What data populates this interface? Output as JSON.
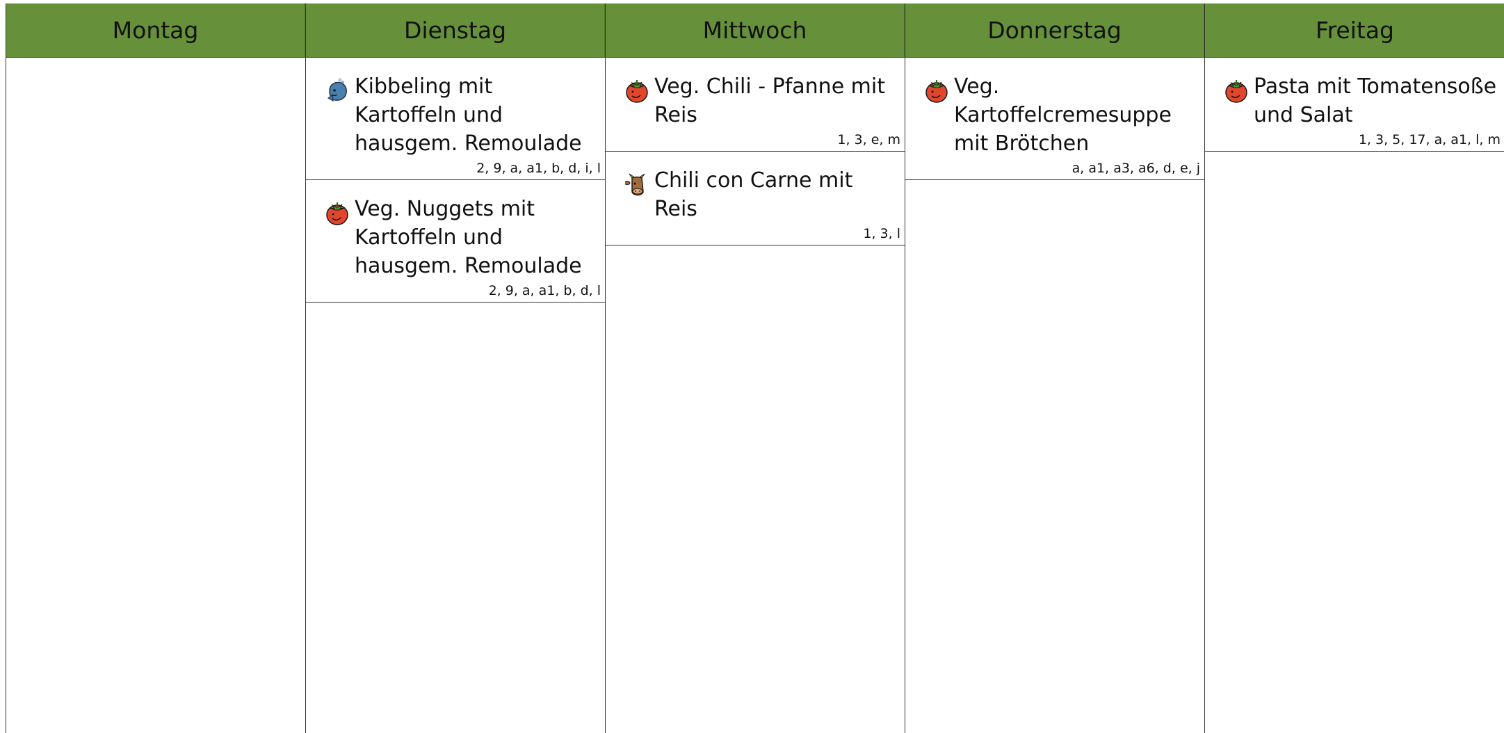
{
  "days": [
    {
      "label": "Montag",
      "meals": []
    },
    {
      "label": "Dienstag",
      "meals": [
        {
          "title": "Kibbeling mit Kartoffeln und hausgem. Remoulade",
          "allergens": "2, 9, a, a1, b, d, i, l",
          "icon": "fish-icon"
        },
        {
          "title": "Veg. Nuggets mit Kartoffeln und hausgem. Remoulade",
          "allergens": "2, 9, a, a1, b, d, l",
          "icon": "vegetarian-tomato-icon"
        }
      ]
    },
    {
      "label": "Mittwoch",
      "meals": [
        {
          "title": "Veg. Chili - Pfanne mit Reis",
          "allergens": "1, 3, e, m",
          "icon": "vegetarian-tomato-icon"
        },
        {
          "title": "Chili con Carne mit Reis",
          "allergens": "1, 3, l",
          "icon": "beef-cow-icon"
        }
      ]
    },
    {
      "label": "Donnerstag",
      "meals": [
        {
          "title": "Veg. Kartoffelcremesuppe mit Brötchen",
          "allergens": "a, a1, a3, a6, d, e, j",
          "icon": "vegetarian-tomato-icon"
        }
      ]
    },
    {
      "label": "Freitag",
      "meals": [
        {
          "title": "Pasta mit Tomatensoße und Salat",
          "allergens": "1, 3, 5, 17, a, a1, l, m",
          "icon": "vegetarian-tomato-icon"
        }
      ]
    }
  ],
  "colors": {
    "header_bg": "#66903a"
  }
}
